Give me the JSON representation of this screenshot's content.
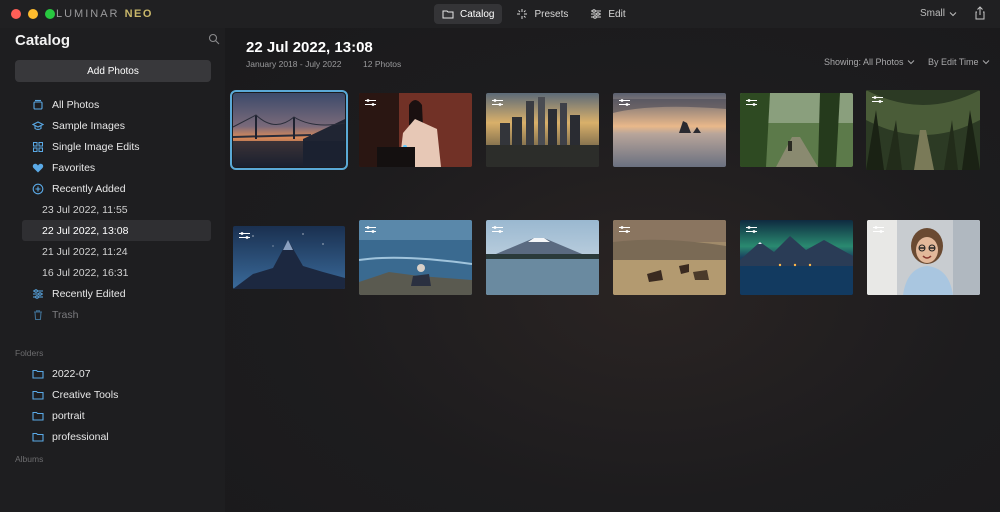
{
  "app": {
    "brand_prefix": "LUMINAR",
    "brand_suffix": "NEO"
  },
  "modes": [
    {
      "label": "Catalog",
      "icon": "folder-icon",
      "active": true
    },
    {
      "label": "Presets",
      "icon": "sparkle-icon",
      "active": false
    },
    {
      "label": "Edit",
      "icon": "sliders-icon",
      "active": false
    }
  ],
  "view_size": "Small",
  "sidebar": {
    "title": "Catalog",
    "add_button": "Add Photos",
    "items": [
      {
        "label": "All Photos",
        "icon": "stack-icon"
      },
      {
        "label": "Sample Images",
        "icon": "cap-icon"
      },
      {
        "label": "Single Image Edits",
        "icon": "grid-icon"
      },
      {
        "label": "Favorites",
        "icon": "heart-icon"
      },
      {
        "label": "Recently Added",
        "icon": "plus-circle-icon"
      }
    ],
    "recent_dates": [
      "23 Jul 2022, 11:55",
      "22 Jul 2022, 13:08",
      "21 Jul 2022, 11:24",
      "16 Jul 2022, 16:31"
    ],
    "selected_date": "22 Jul 2022, 13:08",
    "after_items": [
      {
        "label": "Recently Edited",
        "icon": "sliders-icon"
      },
      {
        "label": "Trash",
        "icon": "trash-icon"
      }
    ],
    "folders_label": "Folders",
    "folders": [
      "2022-07",
      "Creative Tools",
      "portrait",
      "professional"
    ],
    "albums_label": "Albums"
  },
  "main": {
    "title": "22 Jul 2022, 13:08",
    "date_range": "January 2018 - July 2022",
    "photo_count": "12 Photos",
    "showing": "Showing: All Photos",
    "sort": "By Edit Time"
  },
  "photos": [
    {
      "subject": "golden-gate-bridge-dusk",
      "edited": false,
      "selected": true
    },
    {
      "subject": "woman-red-wall",
      "edited": true,
      "selected": false
    },
    {
      "subject": "city-skyline-sunset",
      "edited": true,
      "selected": false
    },
    {
      "subject": "sea-stacks-sunset",
      "edited": true,
      "selected": false
    },
    {
      "subject": "jungle-path",
      "edited": true,
      "selected": false
    },
    {
      "subject": "dark-hedges-trees",
      "edited": true,
      "selected": false
    },
    {
      "subject": "mountain-starry-sky",
      "edited": true,
      "selected": false
    },
    {
      "subject": "sea-coast-person",
      "edited": true,
      "selected": false
    },
    {
      "subject": "mount-fuji-lake",
      "edited": true,
      "selected": false
    },
    {
      "subject": "horses-grazing",
      "edited": true,
      "selected": false
    },
    {
      "subject": "aurora-village",
      "edited": true,
      "selected": false
    },
    {
      "subject": "smiling-woman-glasses",
      "edited": true,
      "selected": false
    }
  ]
}
